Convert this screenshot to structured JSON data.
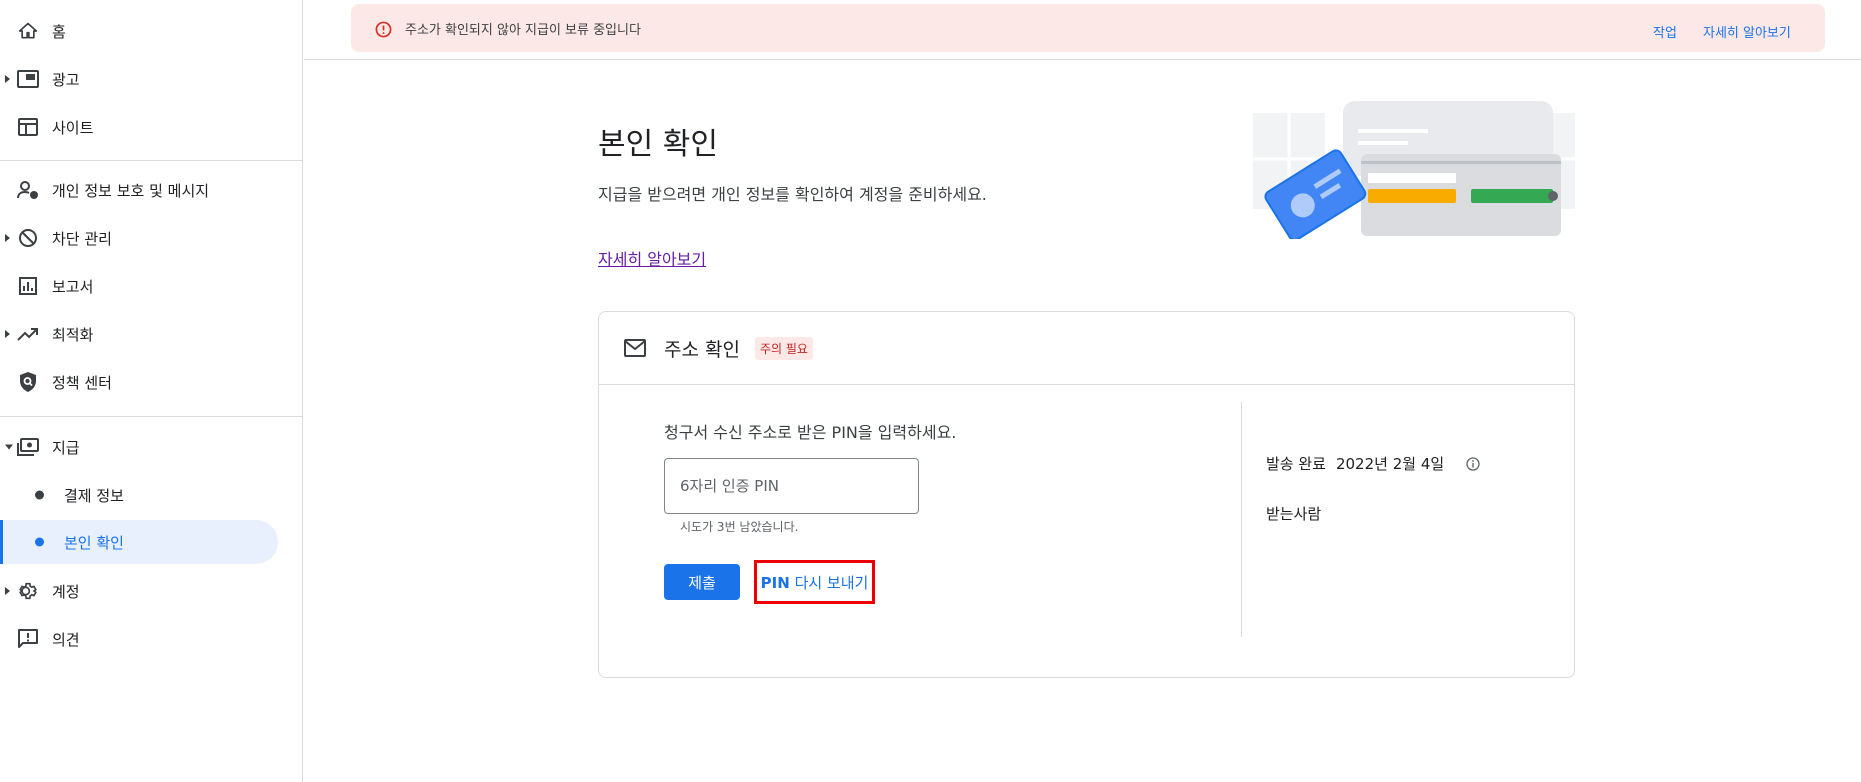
{
  "sidebar": {
    "items": [
      {
        "label": "홈",
        "icon": "home-icon"
      },
      {
        "label": "광고",
        "icon": "ad-unit-icon"
      },
      {
        "label": "사이트",
        "icon": "web-icon"
      },
      {
        "label": "개인 정보 보호 및 메시지",
        "icon": "person-privacy-icon"
      },
      {
        "label": "차단 관리",
        "icon": "block-icon"
      },
      {
        "label": "보고서",
        "icon": "bar-chart-icon"
      },
      {
        "label": "최적화",
        "icon": "trending-up-icon"
      },
      {
        "label": "정책 센터",
        "icon": "policy-shield-icon"
      },
      {
        "label": "지급",
        "icon": "payments-icon"
      },
      {
        "label": "결제 정보"
      },
      {
        "label": "본인 확인"
      },
      {
        "label": "계정",
        "icon": "gear-icon"
      },
      {
        "label": "의견",
        "icon": "feedback-icon"
      }
    ]
  },
  "alert": {
    "message": "주소가 확인되지 않아 지급이 보류 중입니다",
    "action_label": "작업",
    "learn_more_label": "자세히 알아보기"
  },
  "main": {
    "title": "본인 확인",
    "description": "지급을 받으려면 개인 정보를 확인하여 계정을 준비하세요.",
    "learn_more": "자세히 알아보기"
  },
  "card": {
    "title": "주소 확인",
    "badge": "주의 필요",
    "instruction": "청구서 수신 주소로 받은 PIN을 입력하세요.",
    "pin_placeholder": "6자리 인증 PIN",
    "pin_value": "",
    "helper": "시도가 3번 남았습니다.",
    "submit_label": "제출",
    "resend_prefix": "PIN",
    "resend_suffix": " 다시 보내기",
    "sent_label": "발송 완료",
    "sent_date": "2022년 2월 4일",
    "recipient_label": "받는사람"
  },
  "colors": {
    "accent": "#1a73e8",
    "alert_bg": "#fce8e6",
    "alert_icon": "#d93025",
    "link_visited": "#681da8",
    "highlight": "#ee0000"
  }
}
